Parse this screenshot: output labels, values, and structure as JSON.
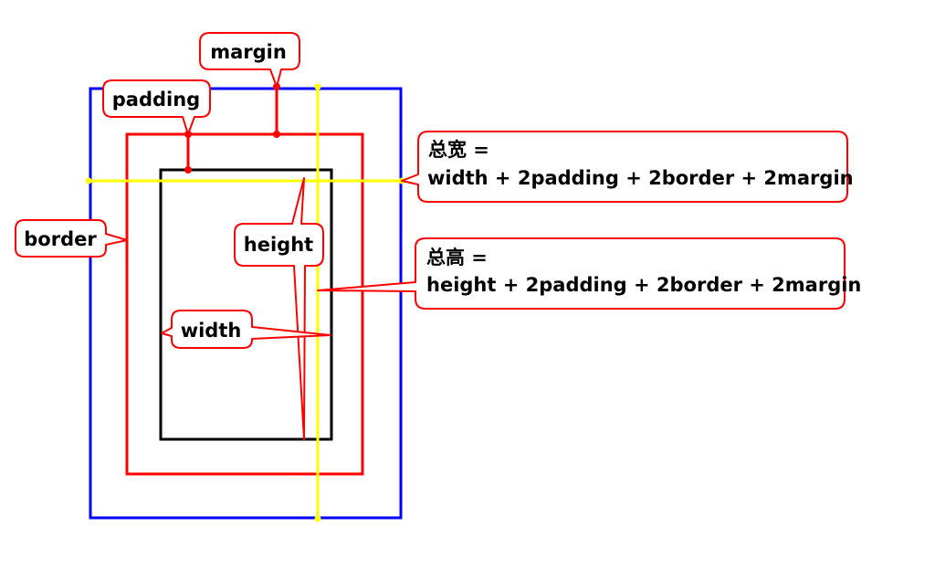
{
  "labels": {
    "margin": "margin",
    "padding": "padding",
    "border": "border",
    "height": "height",
    "width": "width"
  },
  "formulas": {
    "total_width_title": "总宽 =",
    "total_width_expr": "width + 2padding + 2border + 2margin",
    "total_height_title": "总高 =",
    "total_height_expr": "height + 2padding + 2border + 2margin"
  },
  "colors": {
    "margin_box": "#0000ff",
    "border_box": "#ff0000",
    "content_box": "#000000",
    "guide_lines": "#ffff00",
    "callout_stroke": "#ff0000",
    "callout_fill": "#ffffff",
    "marker": "#ff0000"
  }
}
